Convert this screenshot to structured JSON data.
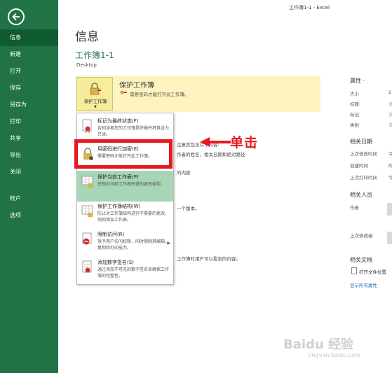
{
  "window": {
    "title": "工作簿1-1 - Excel"
  },
  "sidebar": {
    "items": [
      {
        "label": "信息",
        "active": true
      },
      {
        "label": "新建"
      },
      {
        "label": "打开"
      },
      {
        "label": "保存"
      },
      {
        "label": "另存为"
      },
      {
        "label": "打印"
      },
      {
        "label": "共享"
      },
      {
        "label": "导出"
      },
      {
        "label": "关闭"
      }
    ],
    "lower_items": [
      {
        "label": "帐户"
      },
      {
        "label": "选项"
      }
    ]
  },
  "main": {
    "title": "信息",
    "workbook_name": "工作簿1-1",
    "location": "Desktop",
    "protect": {
      "button_label": "保护工作簿",
      "heading": "保护工作簿",
      "description": "需要密码才能打开此工作簿。"
    },
    "bg_text": {
      "t1": "注意其包含以下内容:",
      "t2": "作者的姓名、相关日期和绝对路径",
      "t3": "的内容",
      "t4": "一个版本。",
      "t5": "工作簿时用户可以看到的内容。"
    }
  },
  "dropdown": {
    "items": [
      {
        "title": "标记为最终状态(F)",
        "desc": "告知读者您的工作簿是终稿并将其设为只读。",
        "icon": "final-icon"
      },
      {
        "title": "用密码进行加密(E)",
        "desc": "需要密码才能打开此工作簿。",
        "icon": "lock-icon"
      },
      {
        "title": "保护当前工作表(P)",
        "desc": "控制对当前工作表所做的更改类型。",
        "icon": "sheet-lock-icon",
        "highlighted": true
      },
      {
        "title": "保护工作簿结构(W)",
        "desc": "防止对工作簿结构进行不需要的更改，例如添加工作表。",
        "icon": "structure-lock-icon"
      },
      {
        "title": "限制访问(R)",
        "desc": "授予用户访问权限，同时限制其编辑、复制和打印能力。",
        "icon": "restrict-icon",
        "has_submenu": true
      },
      {
        "title": "添加数字签名(S)",
        "desc": "通过添加不可见的数字签名来确保工作簿的完整性。",
        "icon": "signature-icon"
      }
    ]
  },
  "annotation": {
    "callout": "单击",
    "color": "#e8171f"
  },
  "properties": {
    "heading": "属性 ·",
    "labels": [
      "大小",
      "标题",
      "标记",
      "类别"
    ],
    "values": [
      "2",
      "添",
      "添",
      "添"
    ],
    "dates_heading": "相关日期",
    "date_labels": [
      "上次修改时间",
      "创建时间",
      "上次打印时间"
    ],
    "date_values": [
      "今",
      "的",
      "今"
    ],
    "people_heading": "相关人员",
    "people_labels": [
      "作者",
      "上次修改者"
    ],
    "docs_heading": "相关文档",
    "open_location": "打开文件位置",
    "show_all": "显示所有属性"
  },
  "watermark": {
    "text": "Baidu 经验",
    "sub": "jingyan.baidu.com"
  },
  "colors": {
    "accent": "#217346",
    "sidebar_active": "#0e5c2f",
    "protect_bg": "#fdf4bf",
    "highlight": "#a6d6b6"
  }
}
